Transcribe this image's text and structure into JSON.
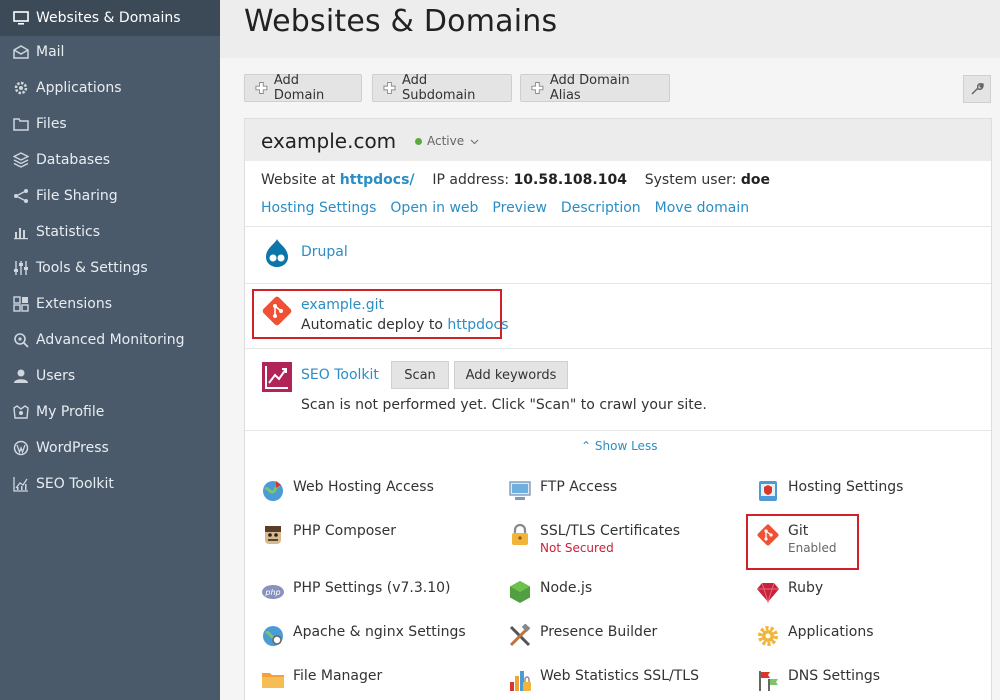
{
  "sidebar": {
    "items": [
      {
        "label": "Websites & Domains",
        "icon": "monitor-icon",
        "active": true
      },
      {
        "label": "Mail",
        "icon": "mail-icon"
      },
      {
        "label": "Applications",
        "icon": "gear-icon"
      },
      {
        "label": "Files",
        "icon": "folder-icon"
      },
      {
        "label": "Databases",
        "icon": "database-icon"
      },
      {
        "label": "File Sharing",
        "icon": "share-icon"
      },
      {
        "label": "Statistics",
        "icon": "bar-chart-icon"
      },
      {
        "label": "Tools & Settings",
        "icon": "sliders-icon"
      },
      {
        "label": "Extensions",
        "icon": "extensions-icon"
      },
      {
        "label": "Advanced Monitoring",
        "icon": "monitoring-icon"
      },
      {
        "label": "Users",
        "icon": "user-icon"
      },
      {
        "label": "My Profile",
        "icon": "profile-icon"
      },
      {
        "label": "WordPress",
        "icon": "wordpress-icon"
      },
      {
        "label": "SEO Toolkit",
        "icon": "seo-chart-icon"
      }
    ]
  },
  "header": {
    "title": "Websites & Domains"
  },
  "toolbar": {
    "add_domain": "Add Domain",
    "add_subdomain": "Add Subdomain",
    "add_alias": "Add Domain Alias"
  },
  "domain": {
    "name": "example.com",
    "status": "Active",
    "website_at_label": "Website at",
    "docroot": "httpdocs/",
    "ip_label": "IP address:",
    "ip": "10.58.108.104",
    "sysuser_label": "System user:",
    "sysuser": "doe",
    "links": [
      "Hosting Settings",
      "Open in web",
      "Preview",
      "Description",
      "Move domain"
    ]
  },
  "drupal": {
    "label": "Drupal"
  },
  "git_repo": {
    "name": "example.git",
    "deploy_text": "Automatic deploy to",
    "deploy_target": "httpdocs"
  },
  "seo": {
    "label": "SEO Toolkit",
    "scan": "Scan",
    "add_keywords": "Add keywords",
    "note": "Scan is not performed yet. Click \"Scan\" to crawl your site."
  },
  "show_less": "Show Less",
  "tools": {
    "col1": [
      "Web Hosting Access",
      "PHP Composer",
      "PHP Settings (v7.3.10)",
      "Apache & nginx Settings",
      "File Manager"
    ],
    "col2": [
      "FTP Access",
      "SSL/TLS Certificates",
      "Node.js",
      "Presence Builder",
      "Web Statistics SSL/TLS"
    ],
    "col3": [
      "Hosting Settings",
      "Git",
      "Ruby",
      "Applications",
      "DNS Settings"
    ],
    "ssl_status": "Not Secured",
    "git_status": "Enabled"
  },
  "colors": {
    "sidebar": "#4b5a6a",
    "link": "#2a8ec5",
    "highlight": "#d0202a",
    "git": "#f05033"
  }
}
